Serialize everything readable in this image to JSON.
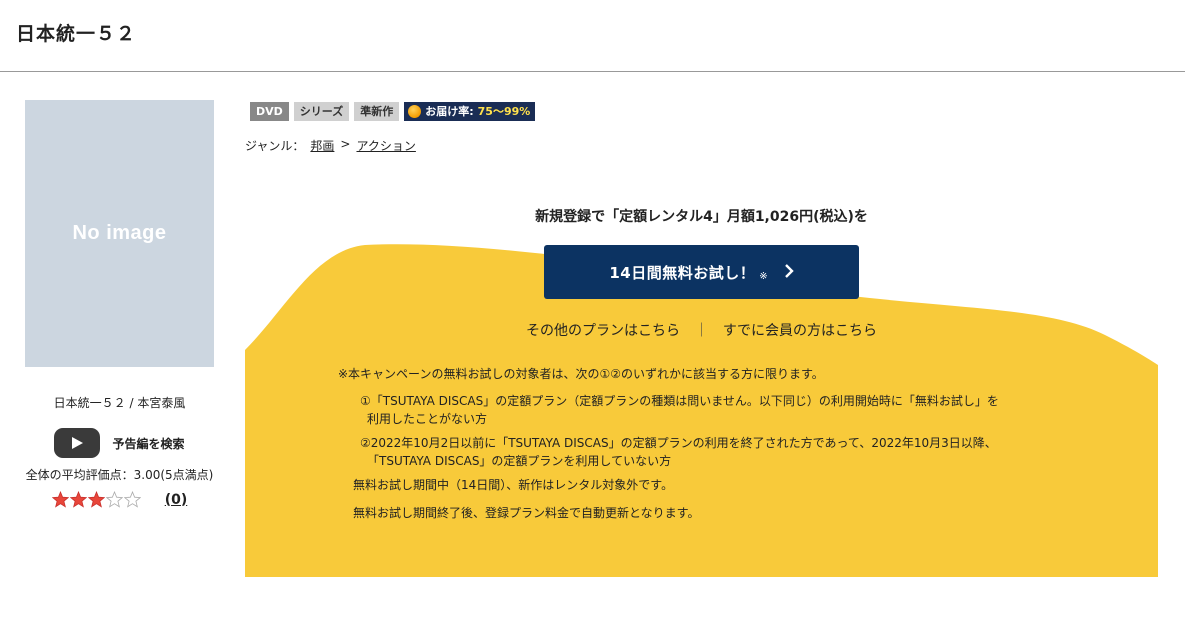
{
  "page": {
    "title": "日本統一５２"
  },
  "left": {
    "noimage_text": "No image",
    "work_meta": "日本統一５２ / 本宮泰風",
    "trailer_label": "予告編を検索",
    "avg_rating_text": "全体の平均評価点：3.00(5点満点)",
    "rating": 3,
    "rating_max": 5,
    "review_count": "(0)"
  },
  "tags": {
    "dvd": "DVD",
    "series": "シリーズ",
    "semi_new": "準新作",
    "delivery_label": "お届け率:",
    "delivery_value": "75〜99%"
  },
  "genre": {
    "label": "ジャンル：",
    "item1": "邦画",
    "sep": ">",
    "item2": "アクション"
  },
  "promo": {
    "headline": "新規登録で「定額レンタル4」月額1,026円(税込)を",
    "button_label": "14日間無料お試し！",
    "button_note": "※",
    "other_plans": "その他のプランはこちら",
    "separator": "｜",
    "member_link": "すでに会員の方はこちら",
    "note_head": "※本キャンペーンの無料お試しの対象者は、次の①②のいずれかに該当する方に限ります。",
    "cond1_line1": "①「TSUTAYA DISCAS」の定額プラン（定額プランの種類は問いません。以下同じ）の利用開始時に「無料お試し」を",
    "cond1_line2": "利用したことがない方",
    "cond2_line1": "②2022年10月2日以前に「TSUTAYA DISCAS」の定額プランの利用を終了された方であって、2022年10月3日以降、",
    "cond2_line2": "「TSUTAYA DISCAS」の定額プランを利用していない方",
    "tail1": "無料お試し期間中（14日間）、新作はレンタル対象外です。",
    "tail2": "無料お試し期間終了後、登録プラン料金で自動更新となります。"
  },
  "colors": {
    "promo_yellow": "#f8ca3a",
    "button_navy": "#0c3362",
    "star_filled": "#e8463a"
  }
}
